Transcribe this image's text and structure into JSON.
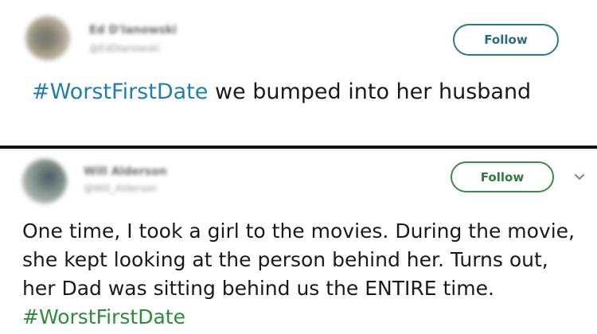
{
  "tweets": [
    {
      "author_name": "Ed D'Ianowski",
      "author_handle": "@EdDIanowski",
      "follow_label": "Follow",
      "hashtag": "#WorstFirstDate",
      "text_after_hashtag": " we bumped into her husband"
    },
    {
      "author_name": "Will Alderson",
      "author_handle": "@Will_Alderson",
      "follow_label": "Follow",
      "text_before_hashtag": "One time, I took a girl to the movies. During the movie, she kept looking at the person behind her. Turns out, her Dad was sitting behind us the ENTIRE time. ",
      "hashtag": "#WorstFirstDate"
    }
  ],
  "colors": {
    "follow_border_1": "#2a7a8c",
    "follow_border_2": "#3b8a45",
    "hashtag_1": "#1f7fae",
    "hashtag_2": "#2e8b3a"
  },
  "icons": {
    "more_options": "chevron-down-icon"
  }
}
